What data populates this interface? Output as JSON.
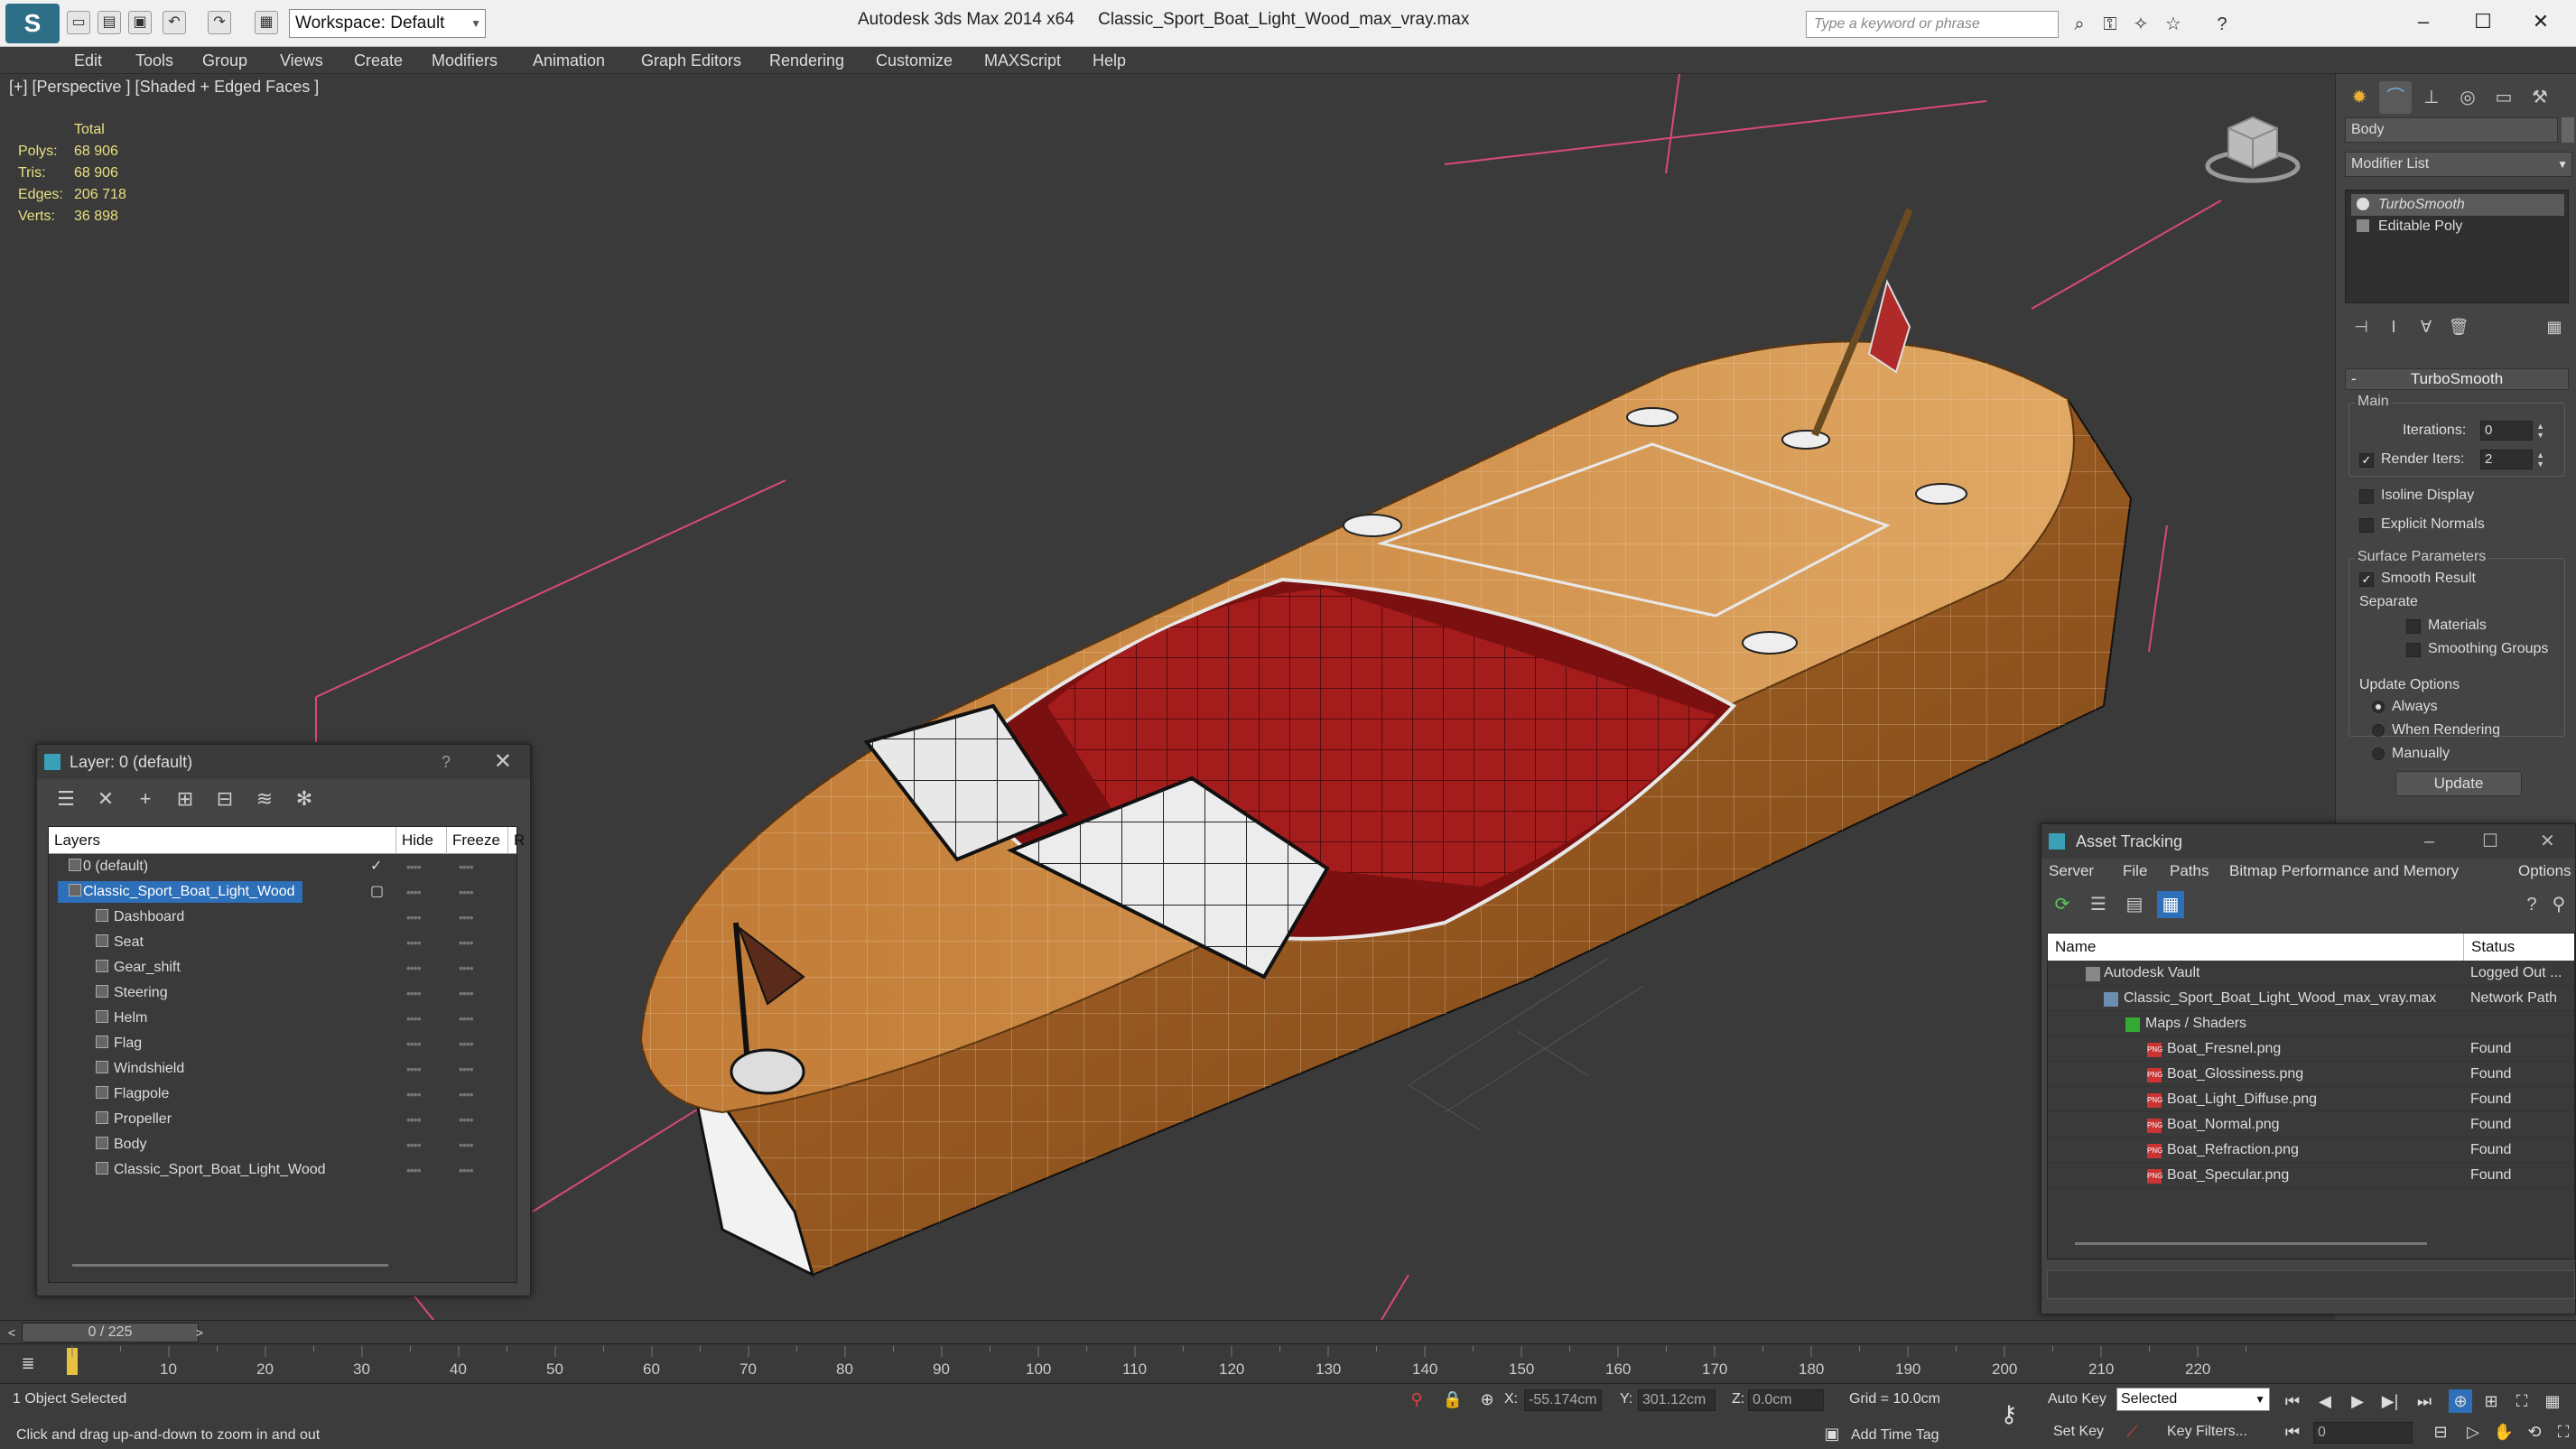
{
  "titlebar": {
    "workspace": "Workspace: Default",
    "app_name": "Autodesk 3ds Max  2014 x64",
    "file_name": "Classic_Sport_Boat_Light_Wood_max_vray.max",
    "search_placeholder": "Type a keyword or phrase"
  },
  "menu": [
    "Edit",
    "Tools",
    "Group",
    "Views",
    "Create",
    "Modifiers",
    "Animation",
    "Graph Editors",
    "Rendering",
    "Customize",
    "MAXScript",
    "Help"
  ],
  "viewport": {
    "label": "[+] [Perspective ] [Shaded + Edged Faces ]",
    "stats_header": "Total",
    "stats": [
      {
        "label": "Polys:",
        "value": "68 906"
      },
      {
        "label": "Tris:",
        "value": "68 906"
      },
      {
        "label": "Edges:",
        "value": "206 718"
      },
      {
        "label": "Verts:",
        "value": "36 898"
      }
    ]
  },
  "command_panel": {
    "object_name": "Body",
    "modifier_list": "Modifier List",
    "stack": [
      "TurboSmooth",
      "Editable Poly"
    ],
    "rollout_title": "TurboSmooth",
    "main_group": "Main",
    "iterations_label": "Iterations:",
    "iterations_value": "0",
    "render_iters_label": "Render Iters:",
    "render_iters_value": "2",
    "isoline_label": "Isoline Display",
    "explicit_normals_label": "Explicit Normals",
    "surface_group": "Surface Parameters",
    "smooth_result_label": "Smooth Result",
    "separate_label": "Separate",
    "materials_label": "Materials",
    "smoothing_groups_label": "Smoothing Groups",
    "update_group": "Update Options",
    "always_label": "Always",
    "when_rendering_label": "When Rendering",
    "manually_label": "Manually",
    "update_button": "Update"
  },
  "layer_window": {
    "title": "Layer: 0 (default)",
    "help": "?",
    "columns": [
      "Layers",
      "Hide",
      "Freeze",
      "R"
    ],
    "rows": [
      {
        "name": "0 (default)",
        "level": 0
      },
      {
        "name": "Classic_Sport_Boat_Light_Wood",
        "level": 0
      },
      {
        "name": "Dashboard",
        "level": 1
      },
      {
        "name": "Seat",
        "level": 1
      },
      {
        "name": "Gear_shift",
        "level": 1
      },
      {
        "name": "Steering",
        "level": 1
      },
      {
        "name": "Helm",
        "level": 1
      },
      {
        "name": "Flag",
        "level": 1
      },
      {
        "name": "Windshield",
        "level": 1
      },
      {
        "name": "Flagpole",
        "level": 1
      },
      {
        "name": "Propeller",
        "level": 1
      },
      {
        "name": "Body",
        "level": 1
      },
      {
        "name": "Classic_Sport_Boat_Light_Wood",
        "level": 1
      }
    ]
  },
  "asset_window": {
    "title": "Asset Tracking",
    "menu": [
      "Server",
      "File",
      "Paths",
      "Bitmap Performance and Memory",
      "Options"
    ],
    "columns": [
      "Name",
      "Status"
    ],
    "rows": [
      {
        "name": "Autodesk Vault",
        "status": "Logged Out ...",
        "level": 0
      },
      {
        "name": "Classic_Sport_Boat_Light_Wood_max_vray.max",
        "status": "Network Path",
        "level": 1
      },
      {
        "name": "Maps / Shaders",
        "status": "",
        "level": 2
      },
      {
        "name": "Boat_Fresnel.png",
        "status": "Found",
        "level": 3
      },
      {
        "name": "Boat_Glossiness.png",
        "status": "Found",
        "level": 3
      },
      {
        "name": "Boat_Light_Diffuse.png",
        "status": "Found",
        "level": 3
      },
      {
        "name": "Boat_Normal.png",
        "status": "Found",
        "level": 3
      },
      {
        "name": "Boat_Refraction.png",
        "status": "Found",
        "level": 3
      },
      {
        "name": "Boat_Specular.png",
        "status": "Found",
        "level": 3
      }
    ]
  },
  "timeline": {
    "frame": "0 / 225",
    "ticks": [
      "10",
      "20",
      "30",
      "40",
      "50",
      "60",
      "70",
      "80",
      "90",
      "100",
      "110",
      "120",
      "130",
      "140",
      "150",
      "160",
      "170",
      "180",
      "190",
      "200",
      "210",
      "220"
    ]
  },
  "status": {
    "selection": "1 Object Selected",
    "prompt": "Click and drag up-and-down to zoom in and out",
    "x_label": "X:",
    "x_value": "-55.174cm",
    "y_label": "Y:",
    "y_value": "301.12cm",
    "z_label": "Z:",
    "z_value": "0.0cm",
    "grid": "Grid = 10.0cm",
    "add_time_tag": "Add Time Tag",
    "auto_key": "Auto Key",
    "set_key": "Set Key",
    "selected": "Selected",
    "key_filters": "Key Filters...",
    "frame_value": "0"
  },
  "colors": {
    "wood": "#c98a45",
    "seat": "#a51c1c",
    "selection": "#2d6fb8",
    "stats": "#e8e080"
  }
}
